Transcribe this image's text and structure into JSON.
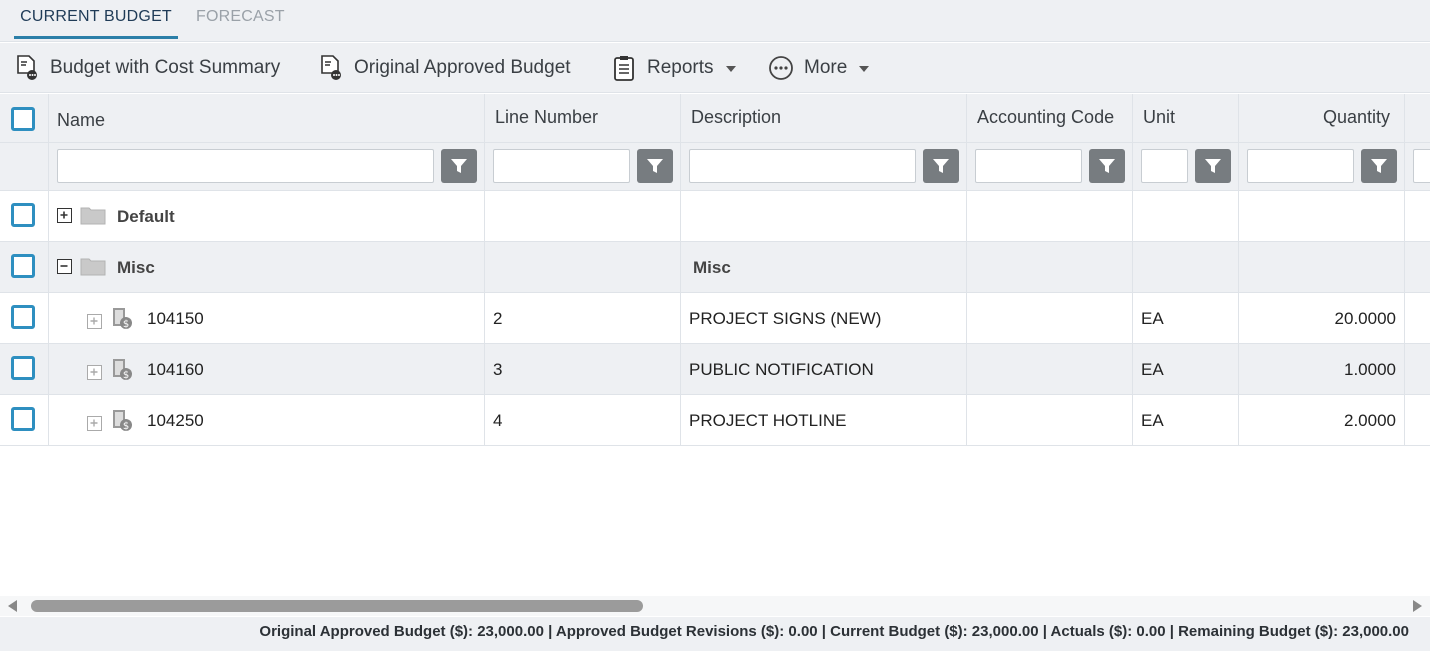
{
  "tabs": [
    {
      "label": "CURRENT BUDGET",
      "active": true
    },
    {
      "label": "FORECAST",
      "active": false
    }
  ],
  "toolbar": {
    "budget_cost_summary": {
      "label": "Budget with Cost Summary",
      "icon": "report-icon"
    },
    "original_approved": {
      "label": "Original Approved Budget",
      "icon": "report-icon"
    },
    "reports": {
      "label": "Reports",
      "icon": "clipboard-icon"
    },
    "more": {
      "label": "More",
      "icon": "ellipsis-circle-icon"
    }
  },
  "columns": {
    "name": "Name",
    "line_number": "Line Number",
    "description": "Description",
    "accounting_code": "Accounting Code",
    "unit": "Unit",
    "quantity": "Quantity"
  },
  "rows": [
    {
      "name": "Default",
      "line": "",
      "description": "",
      "code": "",
      "unit": "",
      "qty": "",
      "type": "group",
      "expanded": false
    },
    {
      "name": "Misc",
      "line": "",
      "description": "Misc",
      "code": "",
      "unit": "",
      "qty": "",
      "type": "group",
      "expanded": true
    },
    {
      "name": "104150",
      "line": "2",
      "description": "PROJECT SIGNS (NEW)",
      "code": "",
      "unit": "EA",
      "qty": "20.0000",
      "type": "item"
    },
    {
      "name": "104160",
      "line": "3",
      "description": "PUBLIC NOTIFICATION",
      "code": "",
      "unit": "EA",
      "qty": "1.0000",
      "type": "item"
    },
    {
      "name": "104250",
      "line": "4",
      "description": "PROJECT HOTLINE",
      "code": "",
      "unit": "EA",
      "qty": "2.0000",
      "type": "item"
    }
  ],
  "footer": {
    "summary": "Original Approved Budget ($): 23,000.00 | Approved Budget Revisions ($): 0.00 | Current Budget ($): 23,000.00 | Actuals ($): 0.00 | Remaining Budget ($): 23,000.00"
  },
  "colors": {
    "accent": "#2b7fa8",
    "checkbox": "#2e8fc0",
    "filter_button": "#777c80",
    "header_bg": "#eef0f3"
  }
}
